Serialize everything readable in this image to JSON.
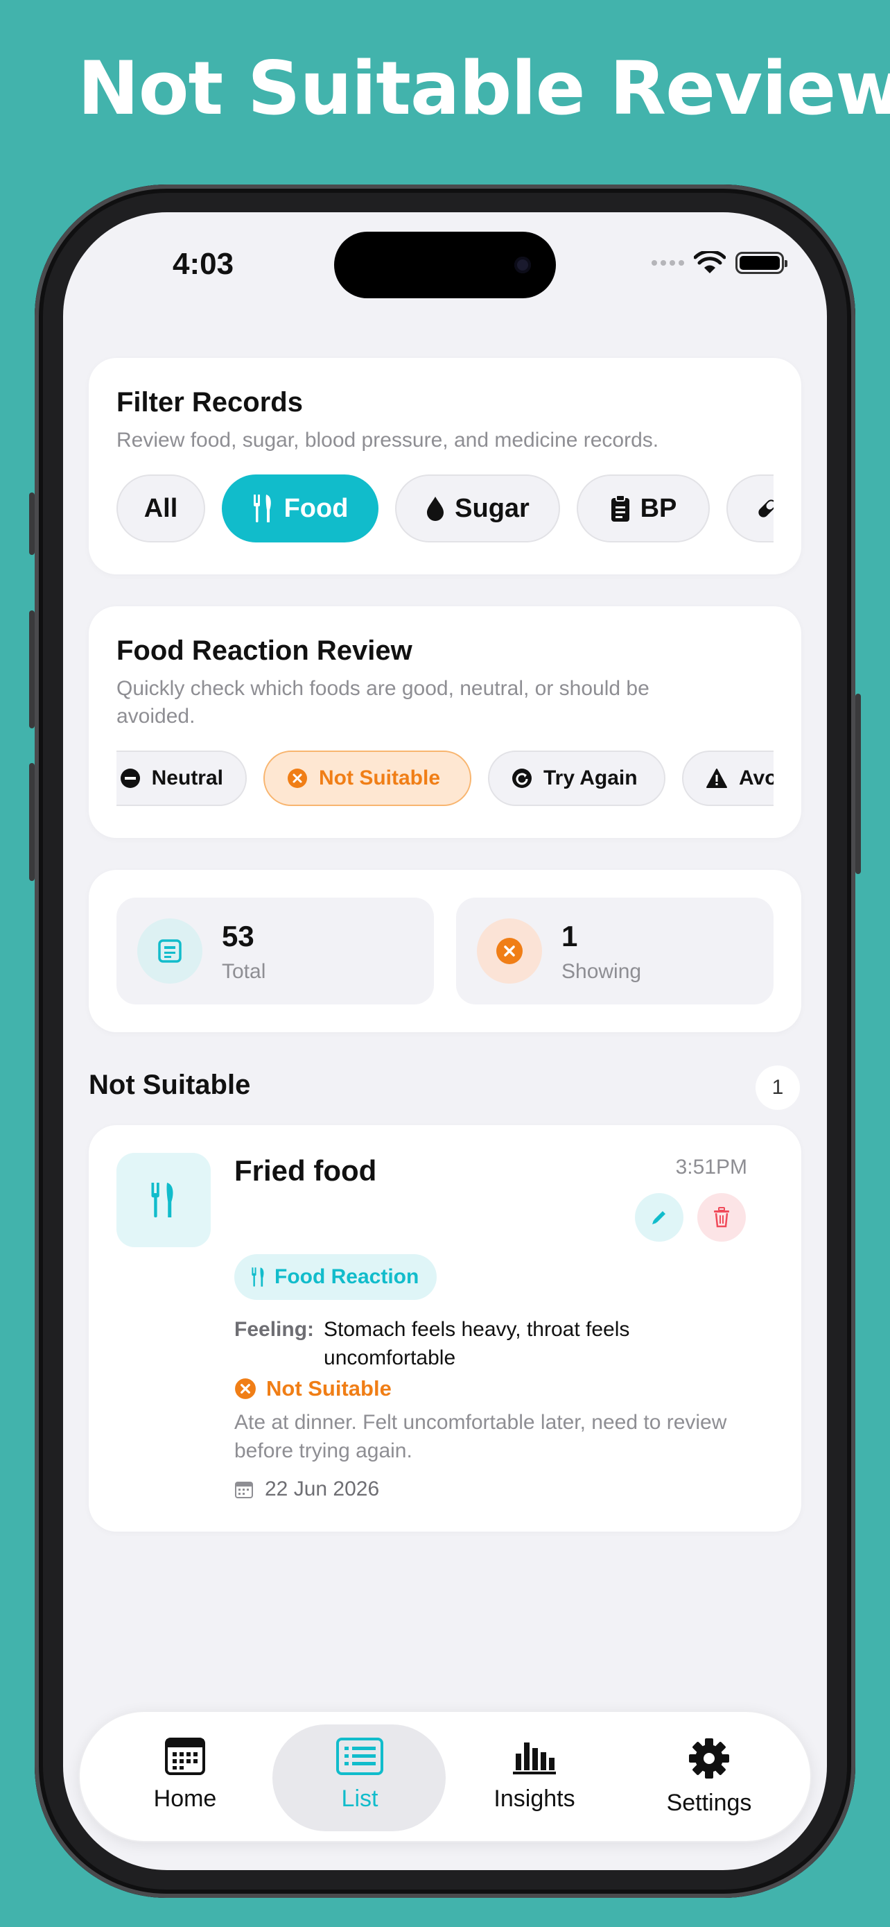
{
  "headline": "Not Suitable Review",
  "status_bar": {
    "time": "4:03"
  },
  "filter_card": {
    "title": "Filter Records",
    "subtitle": "Review food, sugar, blood pressure, and medicine records.",
    "chips": [
      {
        "label": "All",
        "icon": "none",
        "active": false
      },
      {
        "label": "Food",
        "icon": "fork-knife-icon",
        "active": true
      },
      {
        "label": "Sugar",
        "icon": "drop-icon",
        "active": false
      },
      {
        "label": "BP",
        "icon": "clipboard-icon",
        "active": false
      },
      {
        "label": "",
        "icon": "pill-icon",
        "active": false
      }
    ]
  },
  "reaction_card": {
    "title": "Food Reaction Review",
    "subtitle": "Quickly check which foods are good, neutral, or should be avoided.",
    "chips": [
      {
        "label": "Neutral",
        "icon": "minus-circle-icon",
        "active": false
      },
      {
        "label": "Not Suitable",
        "icon": "x-circle-icon",
        "active": true
      },
      {
        "label": "Try Again",
        "icon": "retry-icon",
        "active": false
      },
      {
        "label": "Avo",
        "icon": "warning-icon",
        "active": false
      }
    ]
  },
  "stats": {
    "total": {
      "value": "53",
      "label": "Total"
    },
    "showing": {
      "value": "1",
      "label": "Showing"
    }
  },
  "section": {
    "title": "Not Suitable",
    "count": "1"
  },
  "record": {
    "title": "Fried food",
    "time": "3:51PM",
    "tag": "Food Reaction",
    "feeling_label": "Feeling:",
    "feeling": "Stomach feels heavy, throat feels uncomfortable",
    "status": "Not Suitable",
    "note": "Ate at dinner. Felt uncomfortable later, need to review before trying again.",
    "date": "22 Jun 2026"
  },
  "tabbar": {
    "items": [
      {
        "label": "Home",
        "icon": "calendar-icon",
        "active": false
      },
      {
        "label": "List",
        "icon": "list-icon",
        "active": true
      },
      {
        "label": "Insights",
        "icon": "bar-chart-icon",
        "active": false
      },
      {
        "label": "Settings",
        "icon": "gear-icon",
        "active": false
      }
    ]
  },
  "colors": {
    "background": "#42B3AC",
    "accent": "#11BCCB",
    "warning": "#F07E16",
    "danger": "#F04A5A"
  }
}
